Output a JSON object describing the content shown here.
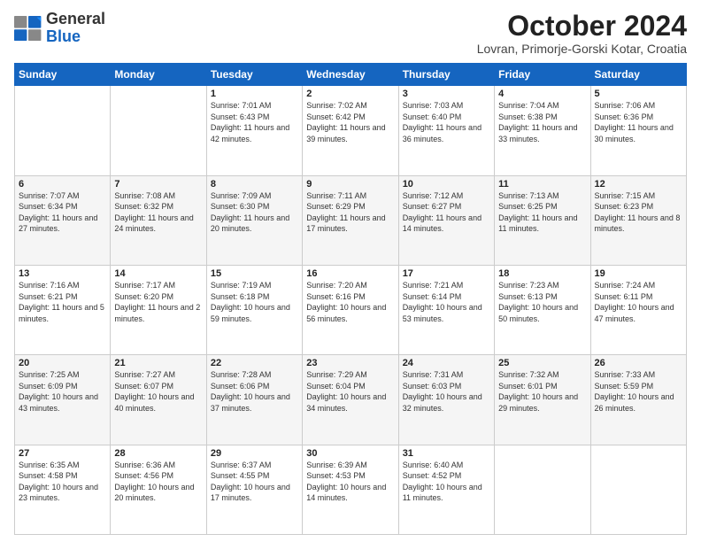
{
  "logo": {
    "general": "General",
    "blue": "Blue"
  },
  "header": {
    "title": "October 2024",
    "subtitle": "Lovran, Primorje-Gorski Kotar, Croatia"
  },
  "weekdays": [
    "Sunday",
    "Monday",
    "Tuesday",
    "Wednesday",
    "Thursday",
    "Friday",
    "Saturday"
  ],
  "weeks": [
    [
      {
        "day": "",
        "sunrise": "",
        "sunset": "",
        "daylight": ""
      },
      {
        "day": "",
        "sunrise": "",
        "sunset": "",
        "daylight": ""
      },
      {
        "day": "1",
        "sunrise": "Sunrise: 7:01 AM",
        "sunset": "Sunset: 6:43 PM",
        "daylight": "Daylight: 11 hours and 42 minutes."
      },
      {
        "day": "2",
        "sunrise": "Sunrise: 7:02 AM",
        "sunset": "Sunset: 6:42 PM",
        "daylight": "Daylight: 11 hours and 39 minutes."
      },
      {
        "day": "3",
        "sunrise": "Sunrise: 7:03 AM",
        "sunset": "Sunset: 6:40 PM",
        "daylight": "Daylight: 11 hours and 36 minutes."
      },
      {
        "day": "4",
        "sunrise": "Sunrise: 7:04 AM",
        "sunset": "Sunset: 6:38 PM",
        "daylight": "Daylight: 11 hours and 33 minutes."
      },
      {
        "day": "5",
        "sunrise": "Sunrise: 7:06 AM",
        "sunset": "Sunset: 6:36 PM",
        "daylight": "Daylight: 11 hours and 30 minutes."
      }
    ],
    [
      {
        "day": "6",
        "sunrise": "Sunrise: 7:07 AM",
        "sunset": "Sunset: 6:34 PM",
        "daylight": "Daylight: 11 hours and 27 minutes."
      },
      {
        "day": "7",
        "sunrise": "Sunrise: 7:08 AM",
        "sunset": "Sunset: 6:32 PM",
        "daylight": "Daylight: 11 hours and 24 minutes."
      },
      {
        "day": "8",
        "sunrise": "Sunrise: 7:09 AM",
        "sunset": "Sunset: 6:30 PM",
        "daylight": "Daylight: 11 hours and 20 minutes."
      },
      {
        "day": "9",
        "sunrise": "Sunrise: 7:11 AM",
        "sunset": "Sunset: 6:29 PM",
        "daylight": "Daylight: 11 hours and 17 minutes."
      },
      {
        "day": "10",
        "sunrise": "Sunrise: 7:12 AM",
        "sunset": "Sunset: 6:27 PM",
        "daylight": "Daylight: 11 hours and 14 minutes."
      },
      {
        "day": "11",
        "sunrise": "Sunrise: 7:13 AM",
        "sunset": "Sunset: 6:25 PM",
        "daylight": "Daylight: 11 hours and 11 minutes."
      },
      {
        "day": "12",
        "sunrise": "Sunrise: 7:15 AM",
        "sunset": "Sunset: 6:23 PM",
        "daylight": "Daylight: 11 hours and 8 minutes."
      }
    ],
    [
      {
        "day": "13",
        "sunrise": "Sunrise: 7:16 AM",
        "sunset": "Sunset: 6:21 PM",
        "daylight": "Daylight: 11 hours and 5 minutes."
      },
      {
        "day": "14",
        "sunrise": "Sunrise: 7:17 AM",
        "sunset": "Sunset: 6:20 PM",
        "daylight": "Daylight: 11 hours and 2 minutes."
      },
      {
        "day": "15",
        "sunrise": "Sunrise: 7:19 AM",
        "sunset": "Sunset: 6:18 PM",
        "daylight": "Daylight: 10 hours and 59 minutes."
      },
      {
        "day": "16",
        "sunrise": "Sunrise: 7:20 AM",
        "sunset": "Sunset: 6:16 PM",
        "daylight": "Daylight: 10 hours and 56 minutes."
      },
      {
        "day": "17",
        "sunrise": "Sunrise: 7:21 AM",
        "sunset": "Sunset: 6:14 PM",
        "daylight": "Daylight: 10 hours and 53 minutes."
      },
      {
        "day": "18",
        "sunrise": "Sunrise: 7:23 AM",
        "sunset": "Sunset: 6:13 PM",
        "daylight": "Daylight: 10 hours and 50 minutes."
      },
      {
        "day": "19",
        "sunrise": "Sunrise: 7:24 AM",
        "sunset": "Sunset: 6:11 PM",
        "daylight": "Daylight: 10 hours and 47 minutes."
      }
    ],
    [
      {
        "day": "20",
        "sunrise": "Sunrise: 7:25 AM",
        "sunset": "Sunset: 6:09 PM",
        "daylight": "Daylight: 10 hours and 43 minutes."
      },
      {
        "day": "21",
        "sunrise": "Sunrise: 7:27 AM",
        "sunset": "Sunset: 6:07 PM",
        "daylight": "Daylight: 10 hours and 40 minutes."
      },
      {
        "day": "22",
        "sunrise": "Sunrise: 7:28 AM",
        "sunset": "Sunset: 6:06 PM",
        "daylight": "Daylight: 10 hours and 37 minutes."
      },
      {
        "day": "23",
        "sunrise": "Sunrise: 7:29 AM",
        "sunset": "Sunset: 6:04 PM",
        "daylight": "Daylight: 10 hours and 34 minutes."
      },
      {
        "day": "24",
        "sunrise": "Sunrise: 7:31 AM",
        "sunset": "Sunset: 6:03 PM",
        "daylight": "Daylight: 10 hours and 32 minutes."
      },
      {
        "day": "25",
        "sunrise": "Sunrise: 7:32 AM",
        "sunset": "Sunset: 6:01 PM",
        "daylight": "Daylight: 10 hours and 29 minutes."
      },
      {
        "day": "26",
        "sunrise": "Sunrise: 7:33 AM",
        "sunset": "Sunset: 5:59 PM",
        "daylight": "Daylight: 10 hours and 26 minutes."
      }
    ],
    [
      {
        "day": "27",
        "sunrise": "Sunrise: 6:35 AM",
        "sunset": "Sunset: 4:58 PM",
        "daylight": "Daylight: 10 hours and 23 minutes."
      },
      {
        "day": "28",
        "sunrise": "Sunrise: 6:36 AM",
        "sunset": "Sunset: 4:56 PM",
        "daylight": "Daylight: 10 hours and 20 minutes."
      },
      {
        "day": "29",
        "sunrise": "Sunrise: 6:37 AM",
        "sunset": "Sunset: 4:55 PM",
        "daylight": "Daylight: 10 hours and 17 minutes."
      },
      {
        "day": "30",
        "sunrise": "Sunrise: 6:39 AM",
        "sunset": "Sunset: 4:53 PM",
        "daylight": "Daylight: 10 hours and 14 minutes."
      },
      {
        "day": "31",
        "sunrise": "Sunrise: 6:40 AM",
        "sunset": "Sunset: 4:52 PM",
        "daylight": "Daylight: 10 hours and 11 minutes."
      },
      {
        "day": "",
        "sunrise": "",
        "sunset": "",
        "daylight": ""
      },
      {
        "day": "",
        "sunrise": "",
        "sunset": "",
        "daylight": ""
      }
    ]
  ]
}
